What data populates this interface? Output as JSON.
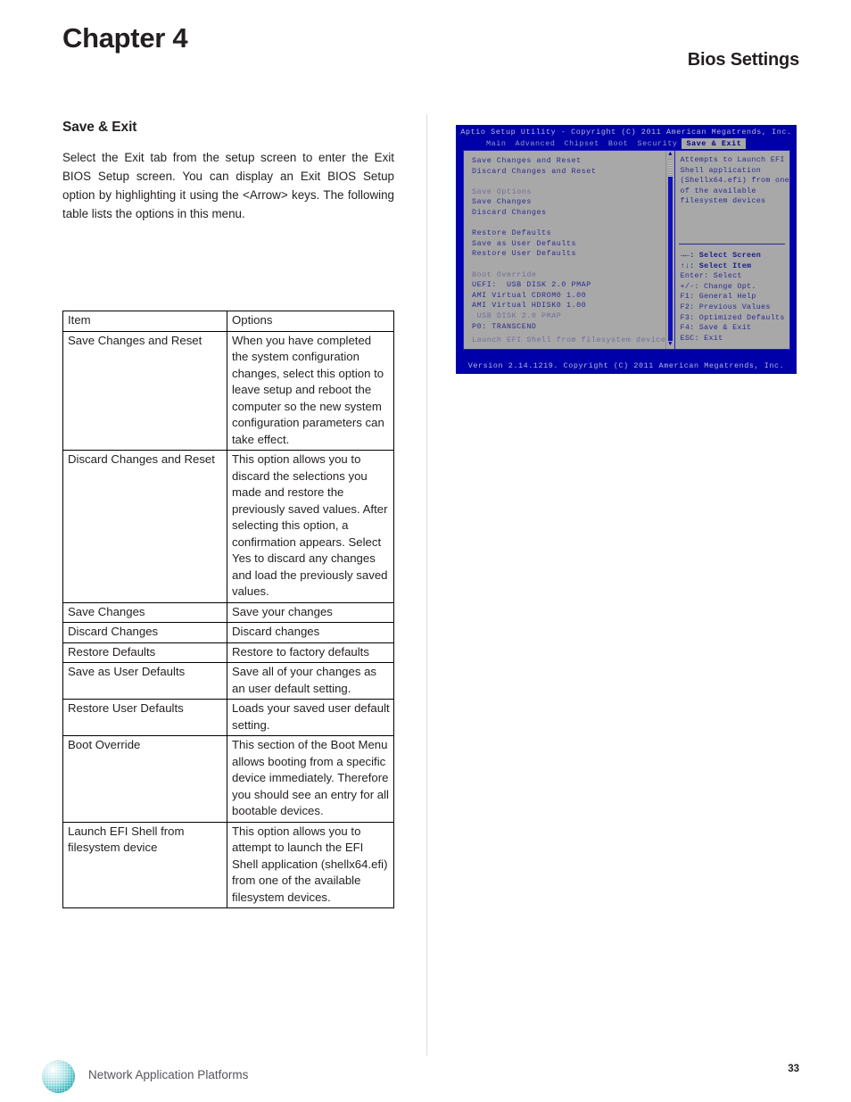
{
  "page": {
    "chapter_title": "Chapter 4",
    "section_header": "Bios Settings",
    "page_number": "33"
  },
  "content": {
    "subhead": "Save & Exit",
    "intro": "Select the Exit tab from the setup screen to enter the Exit BIOS Setup screen. You can display an Exit BIOS Setup option by highlighting it using the <Arrow> keys. The following table lists the options in this menu."
  },
  "table": {
    "headers": [
      "Item",
      "Options"
    ],
    "rows": [
      {
        "item": "Save Changes and Reset",
        "options": "When you have completed the system configuration changes, select this option to leave setup and reboot the computer so the new system configuration parameters can take effect."
      },
      {
        "item": "Discard Changes and Reset",
        "options": "This option allows you to discard the selections you made and restore the previously saved values. After selecting this option, a confirmation appears. Select Yes to discard any changes and load the previously saved values."
      },
      {
        "item": "Save Changes",
        "options": "Save your changes"
      },
      {
        "item": "Discard Changes",
        "options": "Discard changes"
      },
      {
        "item": "Restore Defaults",
        "options": "Restore to factory defaults"
      },
      {
        "item": "Save as User Defaults",
        "options": "Save all of your changes as an user default setting."
      },
      {
        "item": "Restore User Defaults",
        "options": "Loads your saved user default setting."
      },
      {
        "item": "Boot Override",
        "options": "This section of the Boot Menu allows booting from a specific device immediately. Therefore you should see an entry for all bootable devices."
      },
      {
        "item": "Launch EFI Shell from filesystem device",
        "options": "This option allows you to attempt to launch the EFI Shell application (shellx64.efi) from one of the available filesystem devices."
      }
    ]
  },
  "bios": {
    "title": "Aptio Setup Utility - Copyright (C) 2011 American Megatrends, Inc.",
    "tabs": [
      {
        "label": "Main",
        "active": false
      },
      {
        "label": "Advanced",
        "active": false
      },
      {
        "label": "Chipset",
        "active": false
      },
      {
        "label": "Boot",
        "active": false
      },
      {
        "label": "Security",
        "active": false
      },
      {
        "label": "Save & Exit",
        "active": true
      }
    ],
    "menu": [
      "Save Changes and Reset",
      "Discard Changes and Reset",
      "",
      "Save Options",
      "Save Changes",
      "Discard Changes",
      "",
      "Restore Defaults",
      "Save as User Defaults",
      "Restore User Defaults",
      "",
      "Boot Override",
      "UEFI:  USB DISK 2.0 PMAP",
      "AMI Virtual CDROM0 1.00",
      "AMI Virtual HDISK0 1.00",
      " USB DISK 2.0 PMAP",
      "P0: TRANSCEND"
    ],
    "launch_item": "Launch EFI Shell from filesystem device",
    "help_text": [
      "Attempts to Launch EFI",
      "Shell application",
      "(Shellx64.efi) from one",
      "of the available",
      "filesystem devices"
    ],
    "keys": [
      {
        "text": "→←: Select Screen",
        "bold": true
      },
      {
        "text": "↑↓: Select Item",
        "bold": true
      },
      {
        "text": "Enter: Select",
        "bold": false
      },
      {
        "text": "+/-: Change Opt.",
        "bold": false
      },
      {
        "text": "F1: General Help",
        "bold": false
      },
      {
        "text": "F2: Previous Values",
        "bold": false
      },
      {
        "text": "F3: Optimized Defaults",
        "bold": false
      },
      {
        "text": "F4: Save & Exit",
        "bold": false
      },
      {
        "text": "ESC: Exit",
        "bold": false
      }
    ],
    "footer": "Version 2.14.1219. Copyright (C) 2011 American Megatrends, Inc.",
    "scroll_up_glyph": "▲",
    "scroll_down_glyph": "▼",
    "colors": {
      "background": "#0000a8",
      "panel": "#a8a8a8",
      "text": "#2b2b8f",
      "dim_text": "#6e6e9c",
      "title_text": "#b9b9d6"
    }
  },
  "footer": {
    "brand": "Network Application Platforms"
  }
}
